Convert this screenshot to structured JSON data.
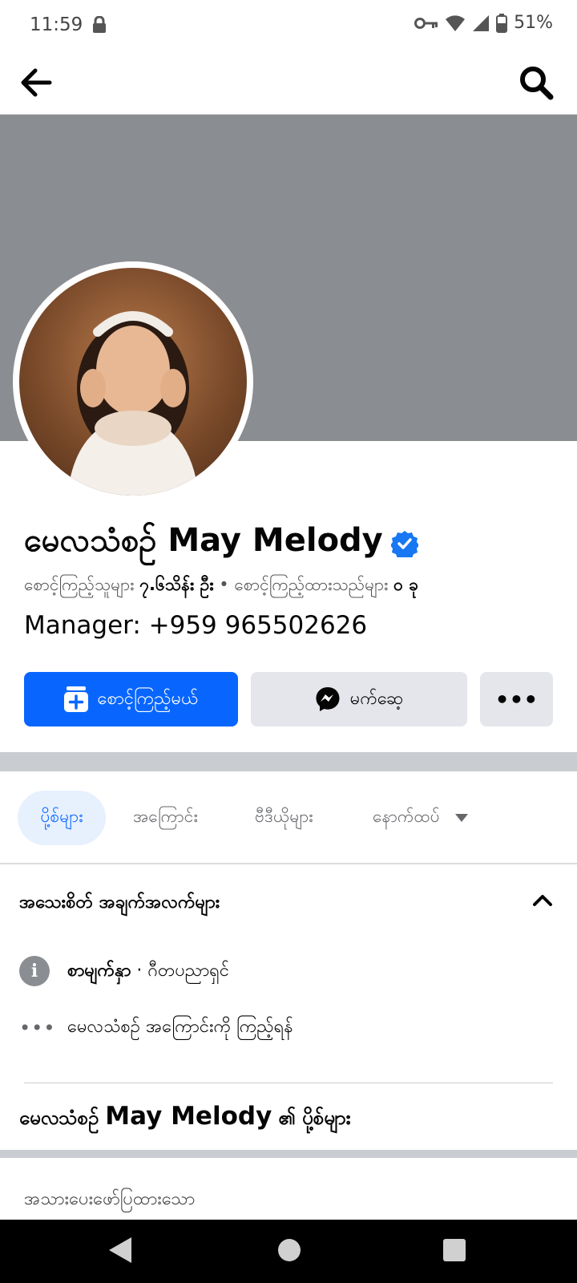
{
  "status_bar": {
    "time": "11:59",
    "battery": "51%"
  },
  "profile": {
    "name": "မေလသံစဉ် May Melody",
    "followers_label": "စောင့်ကြည့်သူများ",
    "followers_value": "၇.၆သိန်း ဦး",
    "following_label": "စောင့်ကြည့်ထားသည်များ",
    "following_value": "၀ ခု",
    "bio": "Manager:  +959 965502626"
  },
  "actions": {
    "follow_label": "စောင့်ကြည့်မယ်",
    "message_label": "မက်ဆေ့",
    "more_label": "•••"
  },
  "tabs": [
    {
      "label": "ပို့စ်များ"
    },
    {
      "label": "အကြောင်း"
    },
    {
      "label": "ဗီဒီယိုများ"
    },
    {
      "label": "နောက်ထပ်"
    }
  ],
  "details": {
    "title": "အသေးစိတ် အချက်အလက်များ",
    "category_label": "စာမျက်နှာ",
    "category_value": "· ဂီတပညာရှင်",
    "see_about": "မေလသံစဉ် အကြောင်းကို ကြည့်ရန်"
  },
  "posts": {
    "title_prefix": "မေလသံစဉ်",
    "title_name": "May Melody",
    "title_suffix": "၏ ပို့စ်များ",
    "pinned": "အသားပေးဖော်ပြထားသော"
  },
  "colors": {
    "accent": "#0866ff",
    "cover": "#8a8d91",
    "button_gray": "#e4e6eb"
  }
}
